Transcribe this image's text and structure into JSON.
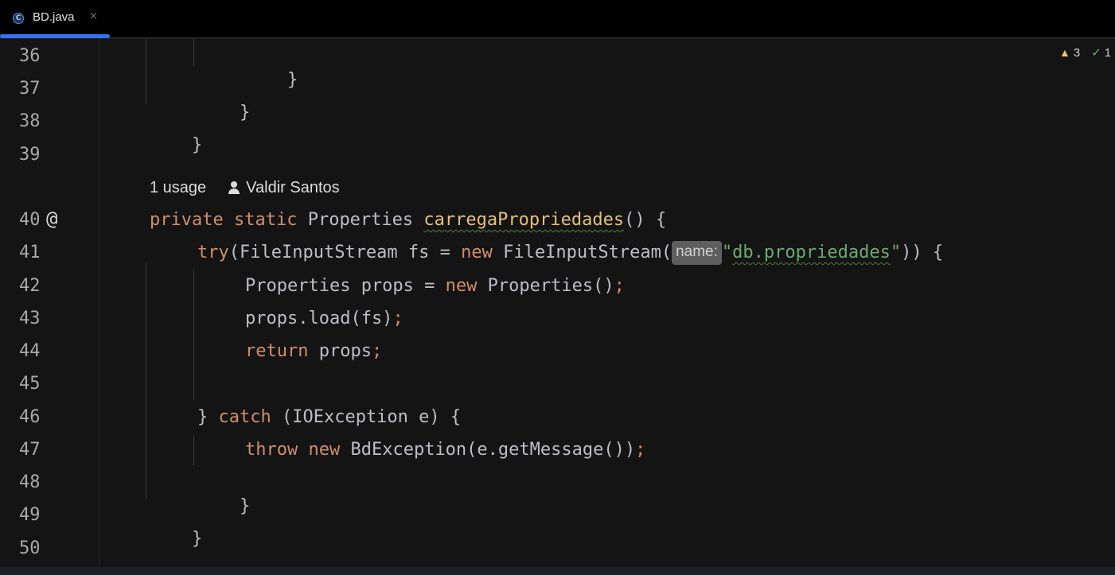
{
  "tab": {
    "icon": "C",
    "label": "BD.java",
    "close": "×"
  },
  "inspections": {
    "warnings": "3",
    "checks": "1"
  },
  "line_numbers": [
    "36",
    "37",
    "38",
    "39",
    "40",
    "41",
    "42",
    "43",
    "44",
    "45",
    "46",
    "47",
    "48",
    "49",
    "50"
  ],
  "code_vision": {
    "usages": "1 usage",
    "author": "Valdir Santos"
  },
  "gutter_marker": "@",
  "code": {
    "l36": "}",
    "l37": "}",
    "l38": "}",
    "l40_kw1": "private",
    "l40_kw2": "static",
    "l40_type": "Properties",
    "l40_fn": "carregaPropriedades",
    "l40_rest": "() {",
    "l41_kw": "try",
    "l41_a": "(FileInputStream fs = ",
    "l41_kw2": "new",
    "l41_b": " FileInputStream(",
    "l41_hint": "name:",
    "l41_str_q1": "\"",
    "l41_str": "db.propriedades",
    "l41_str_q2": "\"",
    "l41_c": ")) {",
    "l42_a": "Properties props = ",
    "l42_kw": "new",
    "l42_b": " Properties()",
    "l43_a": "props.load(fs)",
    "l44_kw": "return",
    "l44_a": " props",
    "l46_a": "} ",
    "l46_kw": "catch",
    "l46_b": " (IOException e) {",
    "l47_kw1": "throw",
    "l47_kw2": "new",
    "l47_a": " BdException(e.getMessage())",
    "l48": "}",
    "l49": "}",
    "semicolon": ";"
  }
}
